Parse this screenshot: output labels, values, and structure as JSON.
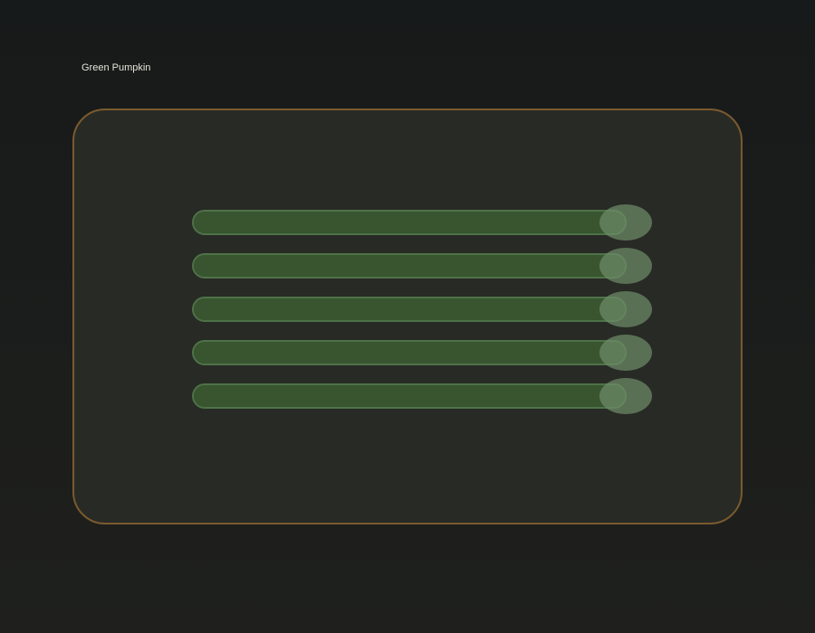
{
  "page": {
    "title": "Green Pumpkin"
  },
  "colors": {
    "accent_border": "#7a5a2e",
    "track": "#35502d",
    "thumb": "#6e8c68"
  },
  "sliders": [
    {
      "value": 1.0
    },
    {
      "value": 1.0
    },
    {
      "value": 1.0
    },
    {
      "value": 1.0
    },
    {
      "value": 1.0
    }
  ]
}
